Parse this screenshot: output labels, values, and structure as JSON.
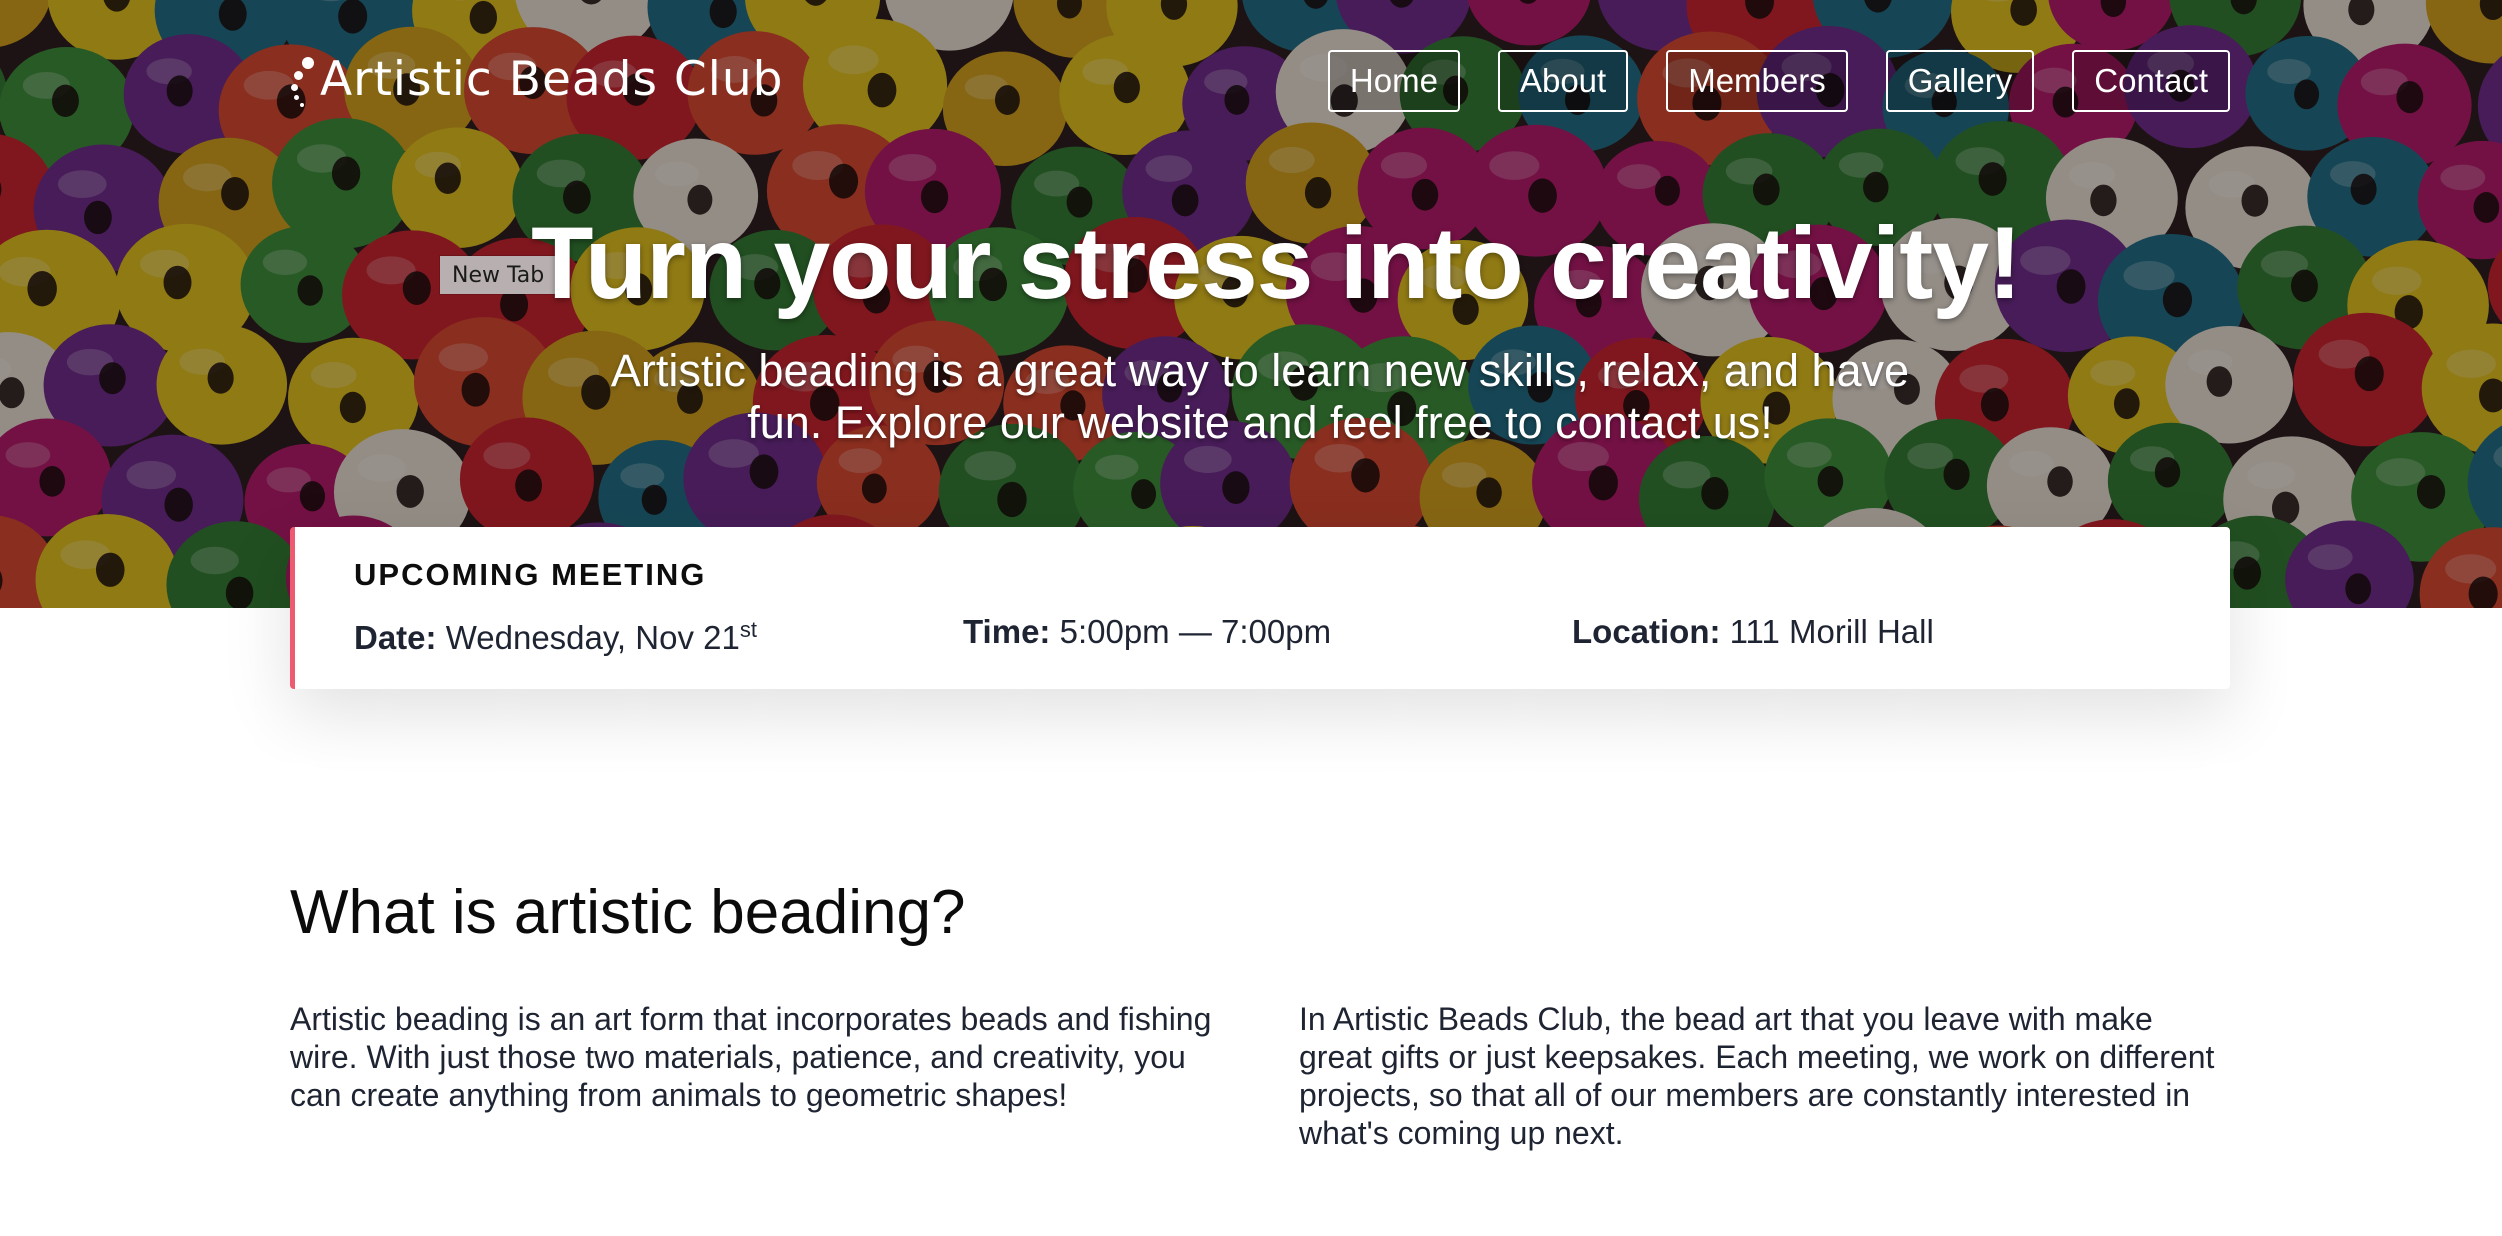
{
  "site": {
    "logo_text": "Artistic Beads Club"
  },
  "nav": {
    "items": [
      {
        "label": "Home"
      },
      {
        "label": "About"
      },
      {
        "label": "Members"
      },
      {
        "label": "Gallery"
      },
      {
        "label": "Contact"
      }
    ]
  },
  "hero": {
    "tag": "New Tab",
    "title": "Turn your stress into creativity!",
    "subtitle": "Artistic beading is a great way to learn new skills, relax, and have fun. Explore our website and feel free to contact us!"
  },
  "meeting": {
    "heading": "UPCOMING MEETING",
    "date_label": "Date:",
    "date_value": "Wednesday, Nov 21",
    "date_suffix": "st",
    "time_label": "Time:",
    "time_value": "5:00pm — 7:00pm",
    "location_label": "Location:",
    "location_value": "111 Morill Hall"
  },
  "about": {
    "title": "What is artistic beading?",
    "col1": "Artistic beading is an art form that incorporates beads and fishing wire. With just those two materials, patience, and creativity, you can create anything from animals to geometric shapes!",
    "col2": "In Artistic Beads Club, the bead art that you leave with make great gifts or just keepsakes. Each meeting, we work on different projects, so that all of our members are constantly interested in what's coming up next."
  },
  "colors": {
    "accent": "#ee5a6f",
    "text_dark": "#1f2433",
    "bead_palette": [
      "#c8232e",
      "#2f7d32",
      "#6c2a8c",
      "#d2a21c",
      "#1e6f86",
      "#e8e1d6",
      "#d8482f",
      "#b3196b",
      "#3a8f3a",
      "#e3c21e"
    ]
  }
}
